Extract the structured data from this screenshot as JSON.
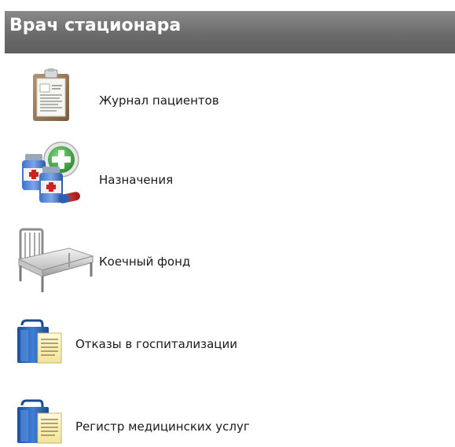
{
  "header": {
    "title": "Врач стационара"
  },
  "menu": {
    "items": [
      {
        "label": "Журнал пациентов",
        "icon": "clipboard-icon"
      },
      {
        "label": "Назначения",
        "icon": "medicine-add-icon"
      },
      {
        "label": "Коечный фонд",
        "icon": "hospital-bed-icon"
      },
      {
        "label": "Отказы в госпитализации",
        "icon": "folder-document-icon"
      },
      {
        "label": "Регистр медицинских услуг",
        "icon": "folder-document-icon"
      }
    ]
  },
  "colors": {
    "header_background": "#6b6b6b",
    "header_text": "#ffffff",
    "label_text": "#1a1a1a"
  }
}
